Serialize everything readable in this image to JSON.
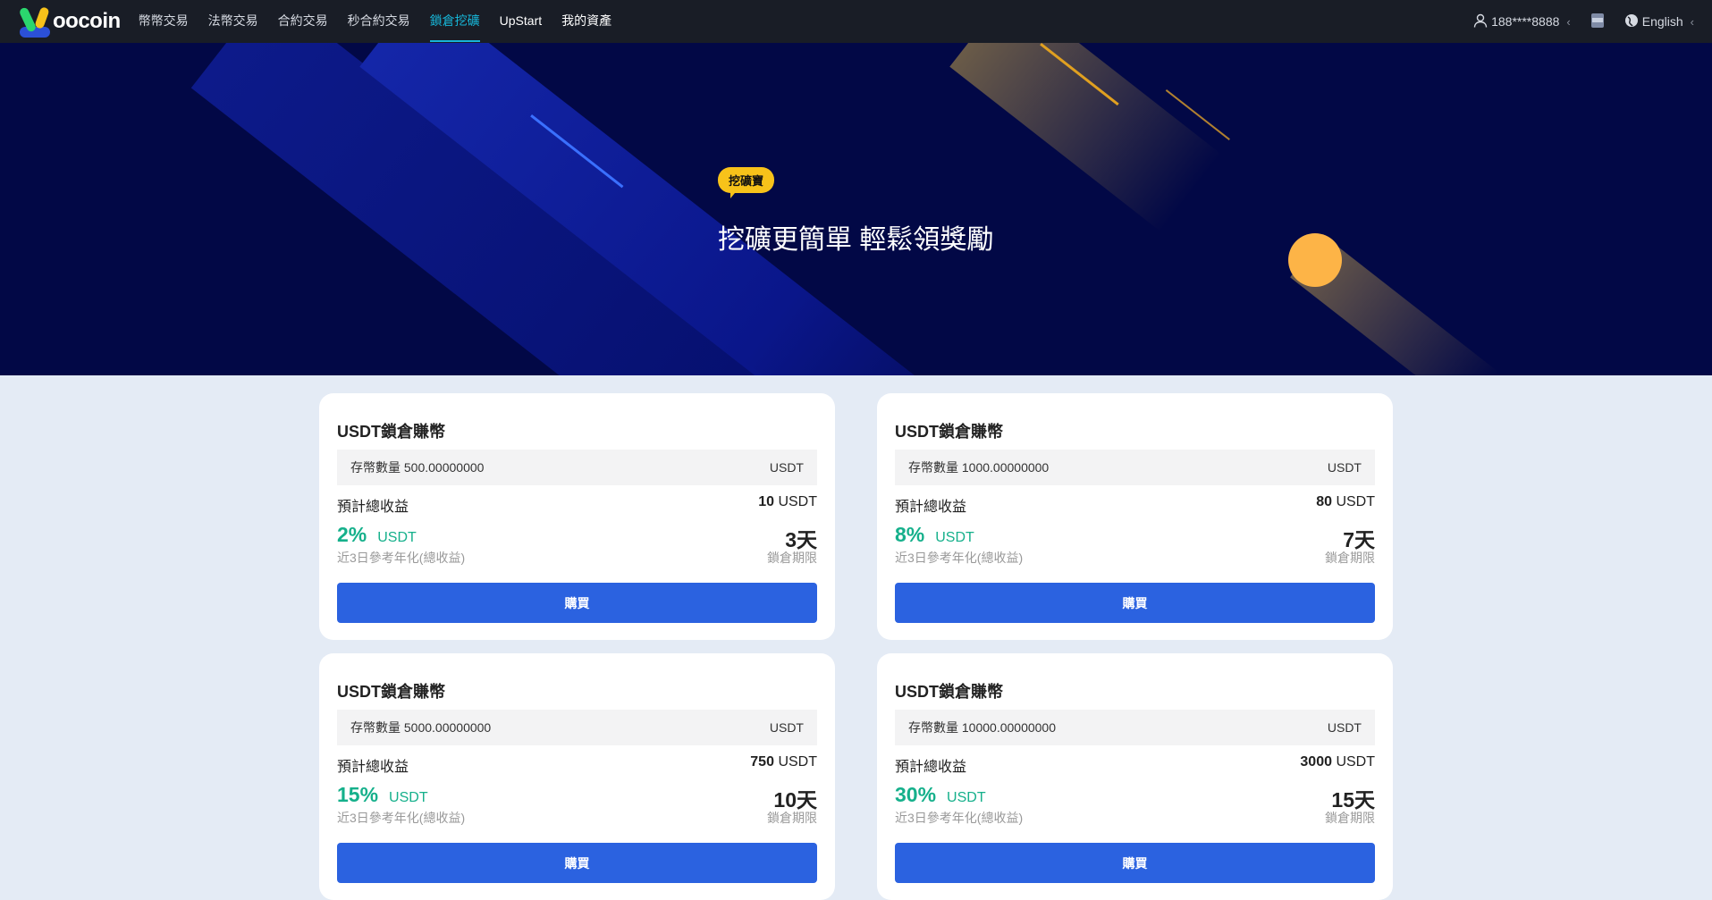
{
  "nav": {
    "logo": "oocoin",
    "items": [
      "幣幣交易",
      "法幣交易",
      "合約交易",
      "秒合約交易",
      "鎖倉挖礦",
      "UpStart",
      "我的資產"
    ],
    "active": "鎖倉挖礦",
    "user": "188****8888",
    "language": "English"
  },
  "banner": {
    "tag": "挖礦寶",
    "title": "挖礦更簡單 輕鬆領獎勵"
  },
  "colors": {
    "accent": "#2b62e0",
    "green": "#15b08b",
    "nav_active": "#17b6d8"
  },
  "cards": [
    {
      "title": "USDT鎖倉賺幣",
      "qty_label": "存幣數量",
      "qty": "500.00000000",
      "qty_unit": "USDT",
      "income_label": "預計總收益",
      "income": "10",
      "income_unit": "USDT",
      "rate": "2%",
      "rate_unit": "USDT",
      "rate_label": "近3日參考年化(總收益)",
      "days": "3天",
      "days_label": "鎖倉期限",
      "button": "購買"
    },
    {
      "title": "USDT鎖倉賺幣",
      "qty_label": "存幣數量",
      "qty": "1000.00000000",
      "qty_unit": "USDT",
      "income_label": "預計總收益",
      "income": "80",
      "income_unit": "USDT",
      "rate": "8%",
      "rate_unit": "USDT",
      "rate_label": "近3日參考年化(總收益)",
      "days": "7天",
      "days_label": "鎖倉期限",
      "button": "購買"
    },
    {
      "title": "USDT鎖倉賺幣",
      "qty_label": "存幣數量",
      "qty": "5000.00000000",
      "qty_unit": "USDT",
      "income_label": "預計總收益",
      "income": "750",
      "income_unit": "USDT",
      "rate": "15%",
      "rate_unit": "USDT",
      "rate_label": "近3日參考年化(總收益)",
      "days": "10天",
      "days_label": "鎖倉期限",
      "button": "購買"
    },
    {
      "title": "USDT鎖倉賺幣",
      "qty_label": "存幣數量",
      "qty": "10000.00000000",
      "qty_unit": "USDT",
      "income_label": "預計總收益",
      "income": "3000",
      "income_unit": "USDT",
      "rate": "30%",
      "rate_unit": "USDT",
      "rate_label": "近3日參考年化(總收益)",
      "days": "15天",
      "days_label": "鎖倉期限",
      "button": "購買"
    }
  ]
}
